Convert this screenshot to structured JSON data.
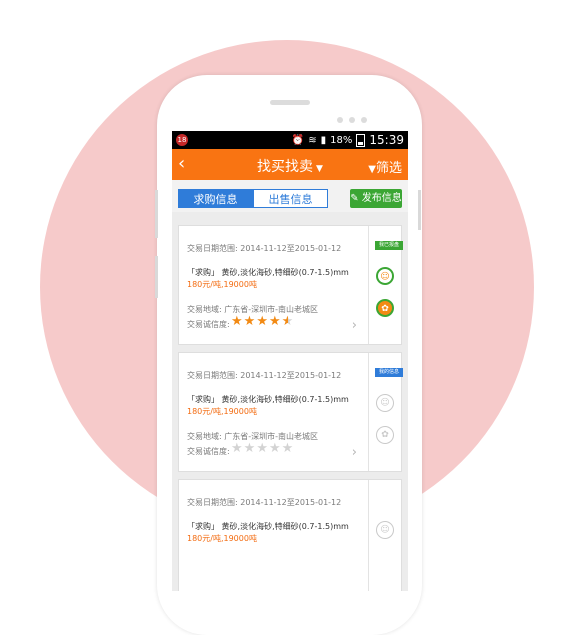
{
  "statusbar": {
    "notification_count": "18",
    "battery_percent": "18%",
    "time": "15:39"
  },
  "header": {
    "back_icon": "‹",
    "title": "找买找卖",
    "filter_label": "筛选"
  },
  "tabs": [
    {
      "label": "求购信息",
      "active": true
    },
    {
      "label": "出售信息",
      "active": false
    }
  ],
  "publish_label": "发布信息",
  "cards": [
    {
      "date_range": "交易日期范围: 2014-11-12至2015-01-12",
      "product": "「求购」 黄砂,淡化海砂,特细砂(0.7-1.5)mm",
      "price": "180元/吨,19000吨",
      "region": "交易地域: 广东省-深圳市-南山老城区",
      "rating_label": "交易诚信度:",
      "rating": 4.5,
      "tag": "我已报盘",
      "tag_color": "#3ba634"
    },
    {
      "date_range": "交易日期范围: 2014-11-12至2015-01-12",
      "product": "「求购」 黄砂,淡化海砂,特细砂(0.7-1.5)mm",
      "price": "180元/吨,19000吨",
      "region": "交易地域: 广东省-深圳市-南山老城区",
      "rating_label": "交易诚信度:",
      "rating": 0,
      "tag": "我的信息",
      "tag_color": "#2f7cd9"
    },
    {
      "date_range": "交易日期范围: 2014-11-12至2015-01-12",
      "product": "「求购」 黄砂,淡化海砂,特细砂(0.7-1.5)mm",
      "price": "180元/吨,19000吨"
    }
  ],
  "colors": {
    "accent_orange": "#f97412",
    "tab_blue": "#2f7cd9",
    "publish_green": "#3ba634",
    "background_circle": "#f6caca"
  }
}
